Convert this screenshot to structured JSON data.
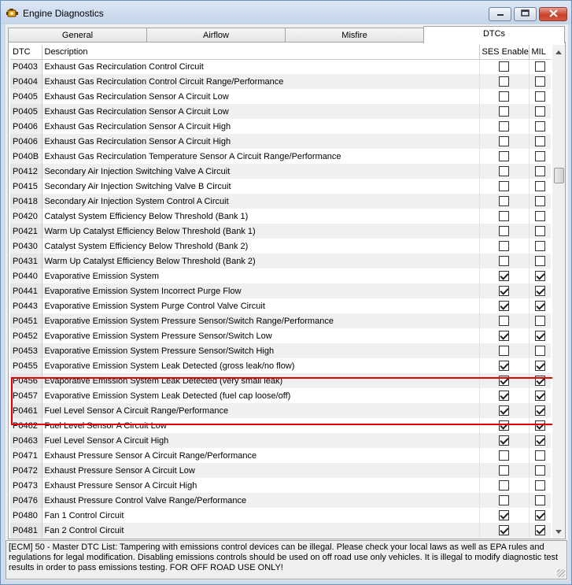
{
  "window": {
    "title": "Engine Diagnostics",
    "icon": "engine-app-icon",
    "controls": [
      "minimize-icon",
      "maximize-icon",
      "close-icon"
    ]
  },
  "tabs": [
    {
      "label": "General",
      "active": false
    },
    {
      "label": "Airflow",
      "active": false
    },
    {
      "label": "Misfire",
      "active": false
    },
    {
      "label": "DTCs",
      "active": true
    }
  ],
  "grid": {
    "columns": [
      "DTC",
      "Description",
      "SES Enable",
      "MIL"
    ],
    "rows": [
      {
        "code": "P0403",
        "desc": "Exhaust Gas Recirculation Control Circuit",
        "ses": false,
        "mil": false
      },
      {
        "code": "P0404",
        "desc": "Exhaust Gas Recirculation Control Circuit Range/Performance",
        "ses": false,
        "mil": false
      },
      {
        "code": "P0405",
        "desc": "Exhaust Gas Recirculation Sensor A Circuit Low",
        "ses": false,
        "mil": false
      },
      {
        "code": "P0405",
        "desc": "Exhaust Gas Recirculation Sensor A Circuit Low",
        "ses": false,
        "mil": false
      },
      {
        "code": "P0406",
        "desc": "Exhaust Gas Recirculation Sensor A Circuit High",
        "ses": false,
        "mil": false
      },
      {
        "code": "P0406",
        "desc": "Exhaust Gas Recirculation Sensor A Circuit High",
        "ses": false,
        "mil": false
      },
      {
        "code": "P040B",
        "desc": "Exhaust Gas Recirculation Temperature Sensor A Circuit Range/Performance",
        "ses": false,
        "mil": false
      },
      {
        "code": "P0412",
        "desc": "Secondary Air Injection Switching Valve A Circuit",
        "ses": false,
        "mil": false
      },
      {
        "code": "P0415",
        "desc": "Secondary Air Injection Switching Valve B Circuit",
        "ses": false,
        "mil": false
      },
      {
        "code": "P0418",
        "desc": "Secondary Air Injection System Control A Circuit",
        "ses": false,
        "mil": false
      },
      {
        "code": "P0420",
        "desc": "Catalyst System Efficiency Below Threshold (Bank 1)",
        "ses": false,
        "mil": false
      },
      {
        "code": "P0421",
        "desc": "Warm Up Catalyst Efficiency Below Threshold (Bank 1)",
        "ses": false,
        "mil": false
      },
      {
        "code": "P0430",
        "desc": "Catalyst System Efficiency Below Threshold (Bank 2)",
        "ses": false,
        "mil": false
      },
      {
        "code": "P0431",
        "desc": "Warm Up Catalyst Efficiency Below Threshold (Bank 2)",
        "ses": false,
        "mil": false
      },
      {
        "code": "P0440",
        "desc": "Evaporative Emission System",
        "ses": true,
        "mil": true
      },
      {
        "code": "P0441",
        "desc": "Evaporative Emission System Incorrect Purge Flow",
        "ses": true,
        "mil": true
      },
      {
        "code": "P0443",
        "desc": "Evaporative Emission System Purge Control Valve Circuit",
        "ses": true,
        "mil": true
      },
      {
        "code": "P0451",
        "desc": "Evaporative Emission System Pressure Sensor/Switch Range/Performance",
        "ses": false,
        "mil": false
      },
      {
        "code": "P0452",
        "desc": "Evaporative Emission System Pressure Sensor/Switch Low",
        "ses": true,
        "mil": true
      },
      {
        "code": "P0453",
        "desc": "Evaporative Emission System Pressure Sensor/Switch High",
        "ses": false,
        "mil": false
      },
      {
        "code": "P0455",
        "desc": "Evaporative Emission System Leak Detected (gross leak/no flow)",
        "ses": true,
        "mil": true
      },
      {
        "code": "P0456",
        "desc": "Evaporative Emission System Leak Detected (very small leak)",
        "ses": true,
        "mil": true
      },
      {
        "code": "P0457",
        "desc": "Evaporative Emission System Leak Detected (fuel cap loose/off)",
        "ses": true,
        "mil": true
      },
      {
        "code": "P0461",
        "desc": "Fuel Level Sensor A Circuit Range/Performance",
        "ses": true,
        "mil": true
      },
      {
        "code": "P0462",
        "desc": "Fuel Level Sensor A Circuit Low",
        "ses": true,
        "mil": true
      },
      {
        "code": "P0463",
        "desc": "Fuel Level Sensor A Circuit High",
        "ses": true,
        "mil": true
      },
      {
        "code": "P0471",
        "desc": "Exhaust Pressure Sensor A Circuit Range/Performance",
        "ses": false,
        "mil": false
      },
      {
        "code": "P0472",
        "desc": "Exhaust Pressure Sensor A Circuit Low",
        "ses": false,
        "mil": false
      },
      {
        "code": "P0473",
        "desc": "Exhaust Pressure Sensor A Circuit High",
        "ses": false,
        "mil": false
      },
      {
        "code": "P0476",
        "desc": "Exhaust Pressure Control Valve Range/Performance",
        "ses": false,
        "mil": false
      },
      {
        "code": "P0480",
        "desc": "Fan 1 Control Circuit",
        "ses": true,
        "mil": true
      },
      {
        "code": "P0481",
        "desc": "Fan 2 Control Circuit",
        "ses": true,
        "mil": true
      }
    ]
  },
  "info_text": "[ECM] 50 - Master DTC List: Tampering with emissions control devices can be illegal. Please check your local laws as well as EPA rules and regulations for legal modification. Disabling emissions controls should be used on off road use only vehicles. It is illegal to modify diagnostic test results in order to pass emissions testing. FOR OFF ROAD USE ONLY!"
}
